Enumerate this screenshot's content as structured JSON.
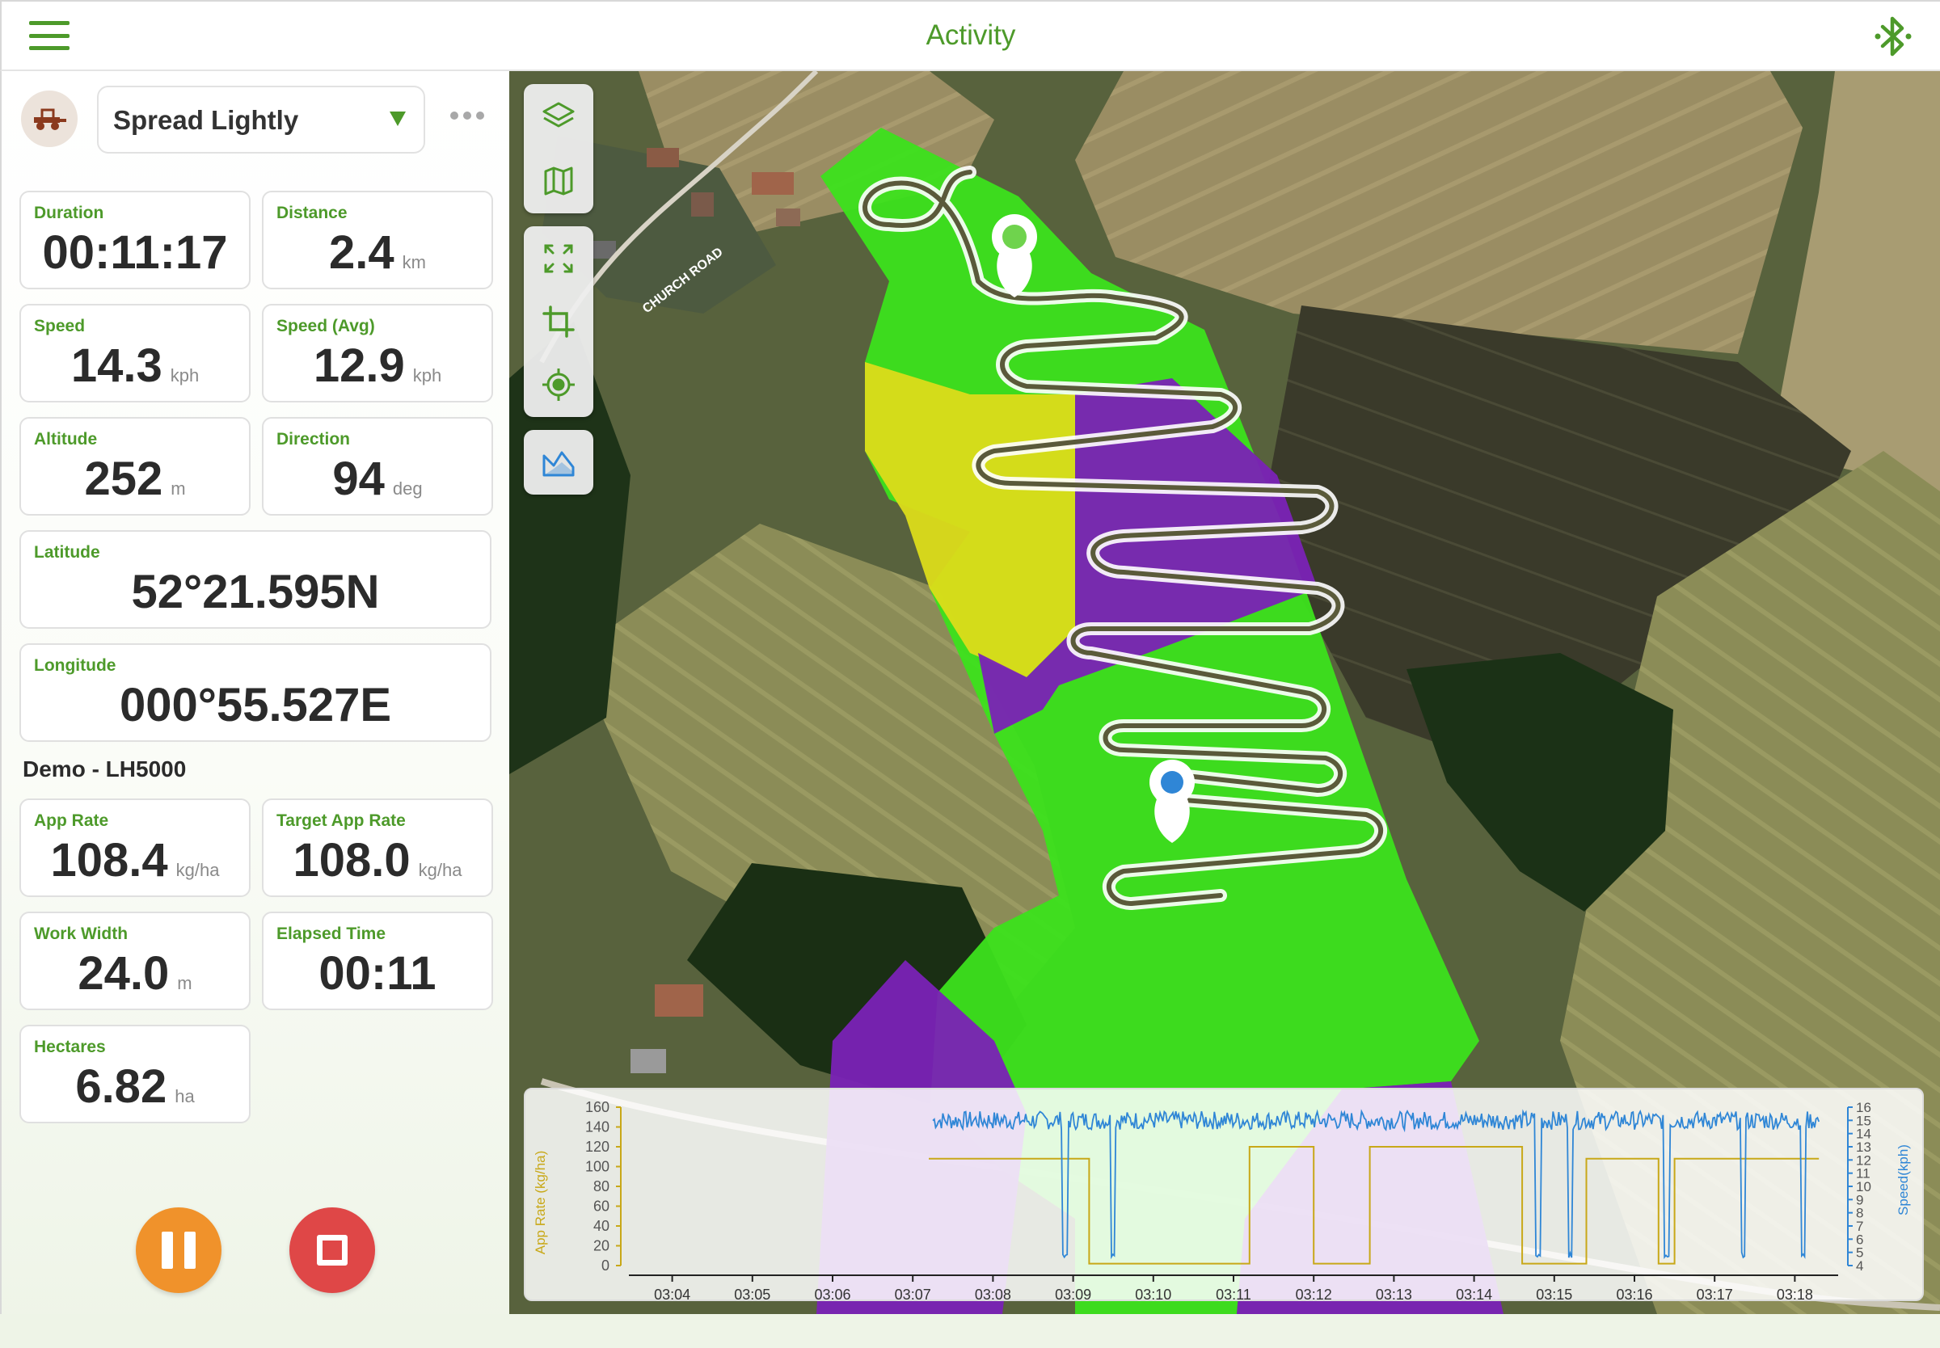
{
  "header": {
    "title": "Activity",
    "bluetooth_icon": "bluetooth-icon",
    "menu_icon": "hamburger-menu-icon"
  },
  "profile": {
    "selected": "Spread Lightly",
    "vehicle_icon": "tractor-icon",
    "more_icon": "more-dots-icon"
  },
  "stats": [
    {
      "label": "Duration",
      "value": "00:11:17",
      "unit": ""
    },
    {
      "label": "Distance",
      "value": "2.4",
      "unit": "km"
    },
    {
      "label": "Speed",
      "value": "14.3",
      "unit": "kph"
    },
    {
      "label": "Speed (Avg)",
      "value": "12.9",
      "unit": "kph"
    },
    {
      "label": "Altitude",
      "value": "252",
      "unit": "m"
    },
    {
      "label": "Direction",
      "value": "94",
      "unit": "deg"
    },
    {
      "label": "Latitude",
      "value": "52°21.595N",
      "unit": ""
    },
    {
      "label": "Longitude",
      "value": "000°55.527E",
      "unit": ""
    }
  ],
  "implement": {
    "name": "Demo - LH5000",
    "stats": [
      {
        "label": "App Rate",
        "value": "108.4",
        "unit": "kg/ha"
      },
      {
        "label": "Target App Rate",
        "value": "108.0",
        "unit": "kg/ha"
      },
      {
        "label": "Work Width",
        "value": "24.0",
        "unit": "m"
      },
      {
        "label": "Elapsed Time",
        "value": "00:11",
        "unit": ""
      },
      {
        "label": "Hectares",
        "value": "6.82",
        "unit": "ha"
      }
    ]
  },
  "controls": {
    "pause_icon": "pause-icon",
    "stop_icon": "stop-icon"
  },
  "map": {
    "road_label": "CHURCH ROAD",
    "tools": [
      "layers-icon",
      "map-icon",
      "fit-extent-icon",
      "crop-icon",
      "locate-icon",
      "terrain-icon"
    ],
    "colors": {
      "on_rate": "#3ce11c",
      "under_rate": "#dcdc1a",
      "no_application": "#7a22b6"
    }
  },
  "chart_data": {
    "type": "line",
    "title": "",
    "ylabel": "App Rate (kg/ha)",
    "y2label": "Speed(kph)",
    "ylim": [
      0,
      160
    ],
    "y2lim": [
      4,
      16
    ],
    "yticks": [
      0,
      20,
      40,
      60,
      80,
      100,
      120,
      140,
      160
    ],
    "y2ticks": [
      4,
      5,
      6,
      7,
      8,
      9,
      10,
      11,
      12,
      13,
      14,
      15,
      16
    ],
    "x_ticks": [
      "03:04",
      "03:05",
      "03:06",
      "03:07",
      "03:08",
      "03:09",
      "03:10",
      "03:11",
      "03:12",
      "03:13",
      "03:14",
      "03:15",
      "03:16",
      "03:17",
      "03:18"
    ],
    "xlim_minutes": [
      3.5,
      18.5
    ],
    "series": [
      {
        "axis": "left",
        "color": "#c8a818",
        "points": [
          [
            7.2,
            108
          ],
          [
            9.2,
            108
          ],
          [
            9.2,
            2
          ],
          [
            11.2,
            2
          ],
          [
            11.2,
            120
          ],
          [
            12.0,
            120
          ],
          [
            12.0,
            2
          ],
          [
            12.7,
            2
          ],
          [
            12.7,
            120
          ],
          [
            14.6,
            120
          ],
          [
            14.6,
            2
          ],
          [
            15.4,
            2
          ],
          [
            15.4,
            108
          ],
          [
            16.3,
            108
          ],
          [
            16.3,
            2
          ],
          [
            16.5,
            2
          ],
          [
            16.5,
            108
          ],
          [
            18.3,
            108
          ]
        ]
      },
      {
        "axis": "right",
        "color": "#2f86d6",
        "base": 15.0,
        "dips": [
          [
            8.9,
            4.6
          ],
          [
            9.5,
            4.6
          ],
          [
            14.8,
            4.6
          ],
          [
            15.2,
            4.6
          ],
          [
            16.4,
            4.6
          ],
          [
            17.35,
            4.6
          ],
          [
            18.1,
            4.6
          ]
        ],
        "xrange": [
          7.25,
          18.3
        ]
      }
    ]
  }
}
